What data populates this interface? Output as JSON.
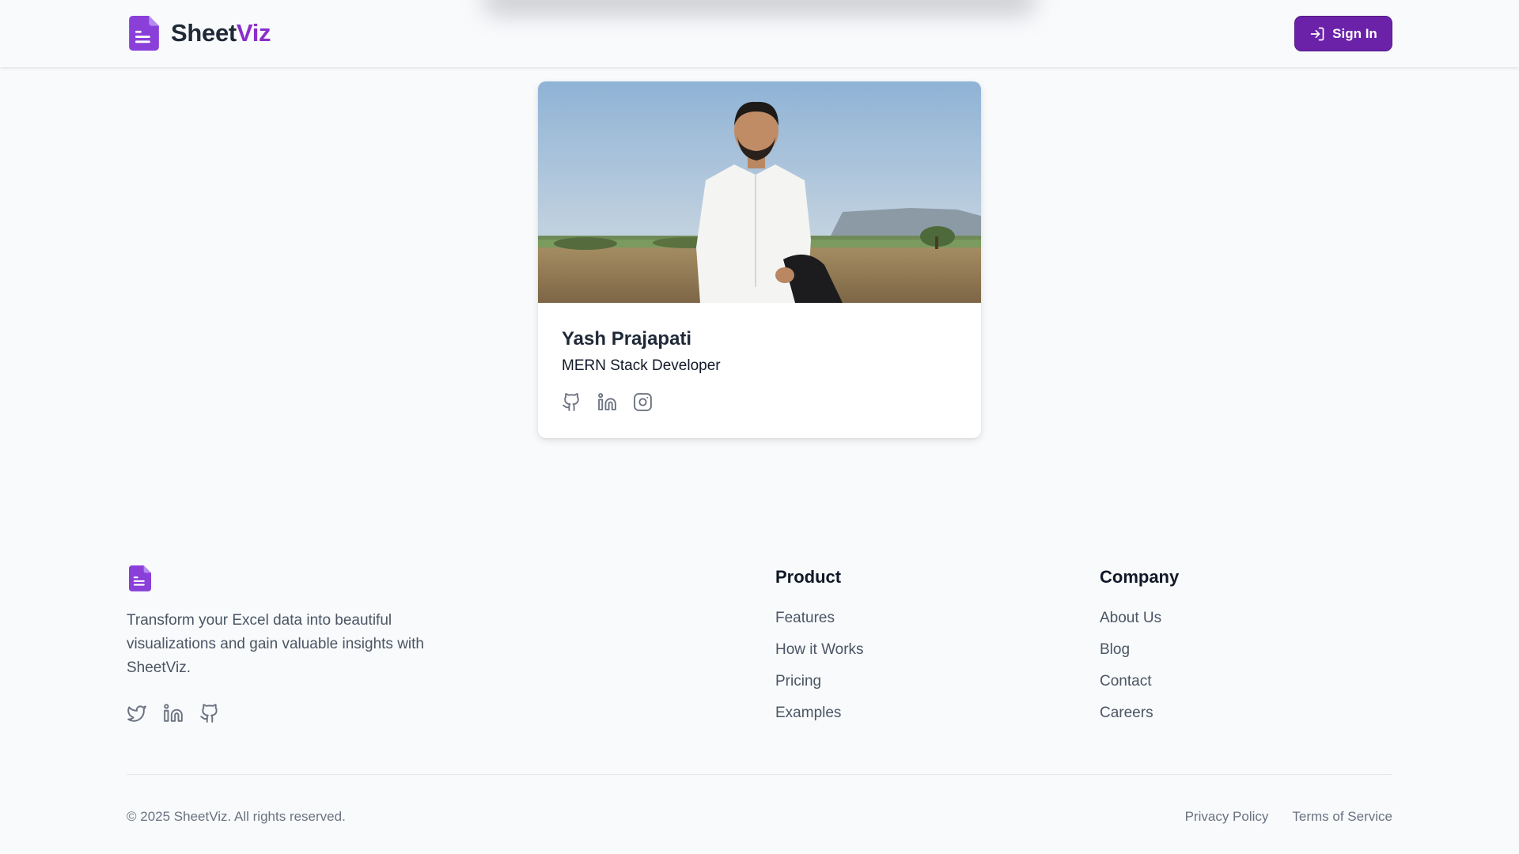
{
  "header": {
    "brand_primary": "Sheet",
    "brand_accent": "Viz",
    "signin_label": "Sign In"
  },
  "colors": {
    "brand_purple": "#8b2fc9",
    "signin_bg": "#6b21a8",
    "page_bg": "#f8fafc"
  },
  "profile": {
    "name": "Yash Prajapati",
    "role": "MERN Stack Developer",
    "social_icons": [
      "github-icon",
      "linkedin-icon",
      "instagram-icon"
    ]
  },
  "footer": {
    "tagline": "Transform your Excel data into beautiful visualizations and gain valuable insights with SheetViz.",
    "social_icons": [
      "twitter-icon",
      "linkedin-icon",
      "github-icon"
    ],
    "product": {
      "title": "Product",
      "links": [
        "Features",
        "How it Works",
        "Pricing",
        "Examples"
      ]
    },
    "company": {
      "title": "Company",
      "links": [
        "About Us",
        "Blog",
        "Contact",
        "Careers"
      ]
    },
    "copyright": "© 2025 SheetViz. All rights reserved.",
    "legal": [
      "Privacy Policy",
      "Terms of Service"
    ]
  }
}
